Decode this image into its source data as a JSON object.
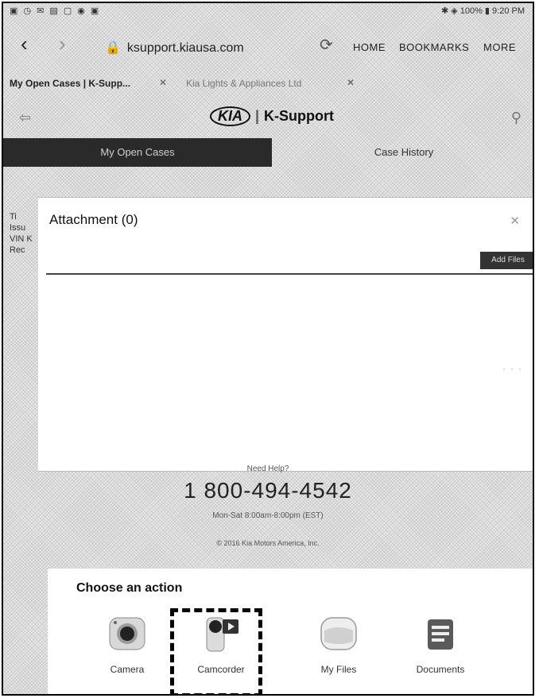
{
  "statusbar": {
    "left": "▣ ◷ ✉ ▤ ▢ ◉ ▣",
    "right": "✱ ◈ 100% ▮ 9:20 PM"
  },
  "browser": {
    "back_icon": "back-arrow-icon",
    "forward_icon": "forward-arrow-icon",
    "url": "ksupport.kiausa.com",
    "menu": {
      "home": "HOME",
      "bookmarks": "BOOKMARKS",
      "more": "MORE"
    },
    "tabs": [
      {
        "label": "My Open Cases | K-Supp..."
      },
      {
        "label": "Kia Lights & Appliances Ltd"
      }
    ]
  },
  "site": {
    "brand": "KIA",
    "name": "K-Support",
    "tabs": {
      "active": "My Open Cases",
      "history": "Case History"
    },
    "bg_text": [
      "Ti",
      "Issu",
      "VIN K",
      "Rec"
    ]
  },
  "modal": {
    "title": "Attachment (0)",
    "close": "✕",
    "add_file": "Add Files"
  },
  "footer": {
    "contact_label": "Need Help?",
    "phone": "1 800-494-4542",
    "hours": "Mon-Sat 8:00am-8:00pm (EST)",
    "copyright": "© 2016 Kia Motors America, Inc."
  },
  "action_sheet": {
    "title": "Choose an action",
    "actions": [
      {
        "label": "Camera",
        "icon": "camera-icon"
      },
      {
        "label": "Camcorder",
        "icon": "camcorder-icon"
      },
      {
        "label": "My Files",
        "icon": "folder-icon"
      },
      {
        "label": "Documents",
        "icon": "documents-icon"
      }
    ]
  }
}
